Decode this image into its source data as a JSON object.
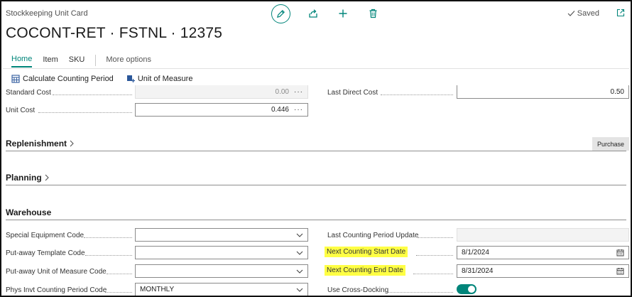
{
  "page": {
    "caption": "Stockkeeping Unit Card",
    "title": "COCONT-RET · FSTNL · 12375",
    "saved_label": "Saved"
  },
  "toolbar": {
    "icons": [
      "edit-icon",
      "share-icon",
      "add-icon",
      "delete-icon"
    ]
  },
  "tabs": [
    {
      "label": "Home",
      "active": true
    },
    {
      "label": "Item"
    },
    {
      "label": "SKU"
    },
    {
      "label": "More options"
    }
  ],
  "actions": [
    {
      "label": "Calculate Counting Period",
      "icon": "calculate-icon"
    },
    {
      "label": "Unit of Measure",
      "icon": "unit-of-measure-icon"
    }
  ],
  "costs": {
    "standard_cost_label": "Standard Cost",
    "standard_cost_value": "0.00",
    "last_direct_cost_label": "Last Direct Cost",
    "last_direct_cost_value": "0.50",
    "unit_cost_label": "Unit Cost",
    "unit_cost_value": "0.446"
  },
  "sections": {
    "replenishment": "Replenishment",
    "purchase_label": "Purchase",
    "planning": "Planning",
    "warehouse": "Warehouse"
  },
  "warehouse": {
    "special_equipment_code_label": "Special Equipment Code",
    "special_equipment_code_value": "",
    "putaway_template_code_label": "Put-away Template Code",
    "putaway_template_code_value": "",
    "putaway_uom_code_label": "Put-away Unit of Measure Code",
    "putaway_uom_code_value": "",
    "phys_invt_counting_period_code_label": "Phys Invt Counting Period Code",
    "phys_invt_counting_period_code_value": "MONTHLY",
    "last_counting_period_update_label": "Last Counting Period Update",
    "last_counting_period_update_value": "",
    "next_counting_start_date_label": "Next Counting Start Date",
    "next_counting_start_date_value": "8/1/2024",
    "next_counting_end_date_label": "Next Counting End Date",
    "next_counting_end_date_value": "8/31/2024",
    "use_cross_docking_label": "Use Cross-Docking",
    "use_cross_docking_value": true
  },
  "colors": {
    "accent": "#00857a",
    "highlight": "#ffff44"
  }
}
